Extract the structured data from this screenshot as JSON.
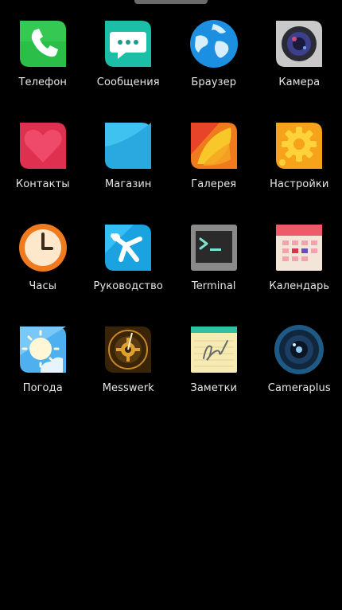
{
  "apps": [
    {
      "label": "Телефон",
      "icon": "phone-icon"
    },
    {
      "label": "Сообщения",
      "icon": "messages-icon"
    },
    {
      "label": "Браузер",
      "icon": "browser-globe-icon"
    },
    {
      "label": "Камера",
      "icon": "camera-icon"
    },
    {
      "label": "Контакты",
      "icon": "contacts-heart-icon"
    },
    {
      "label": "Магазин",
      "icon": "store-icon"
    },
    {
      "label": "Галерея",
      "icon": "gallery-icon"
    },
    {
      "label": "Настройки",
      "icon": "settings-gear-icon"
    },
    {
      "label": "Часы",
      "icon": "clock-icon"
    },
    {
      "label": "Руководство",
      "icon": "tutorial-icon"
    },
    {
      "label": "Terminal",
      "icon": "terminal-icon"
    },
    {
      "label": "Календарь",
      "icon": "calendar-icon"
    },
    {
      "label": "Погода",
      "icon": "weather-icon"
    },
    {
      "label": "Messwerk",
      "icon": "messwerk-icon"
    },
    {
      "label": "Заметки",
      "icon": "notes-icon"
    },
    {
      "label": "Cameraplus",
      "icon": "cameraplus-icon"
    }
  ],
  "colors": {
    "background": "#000000",
    "label": "#e6e6e6"
  }
}
